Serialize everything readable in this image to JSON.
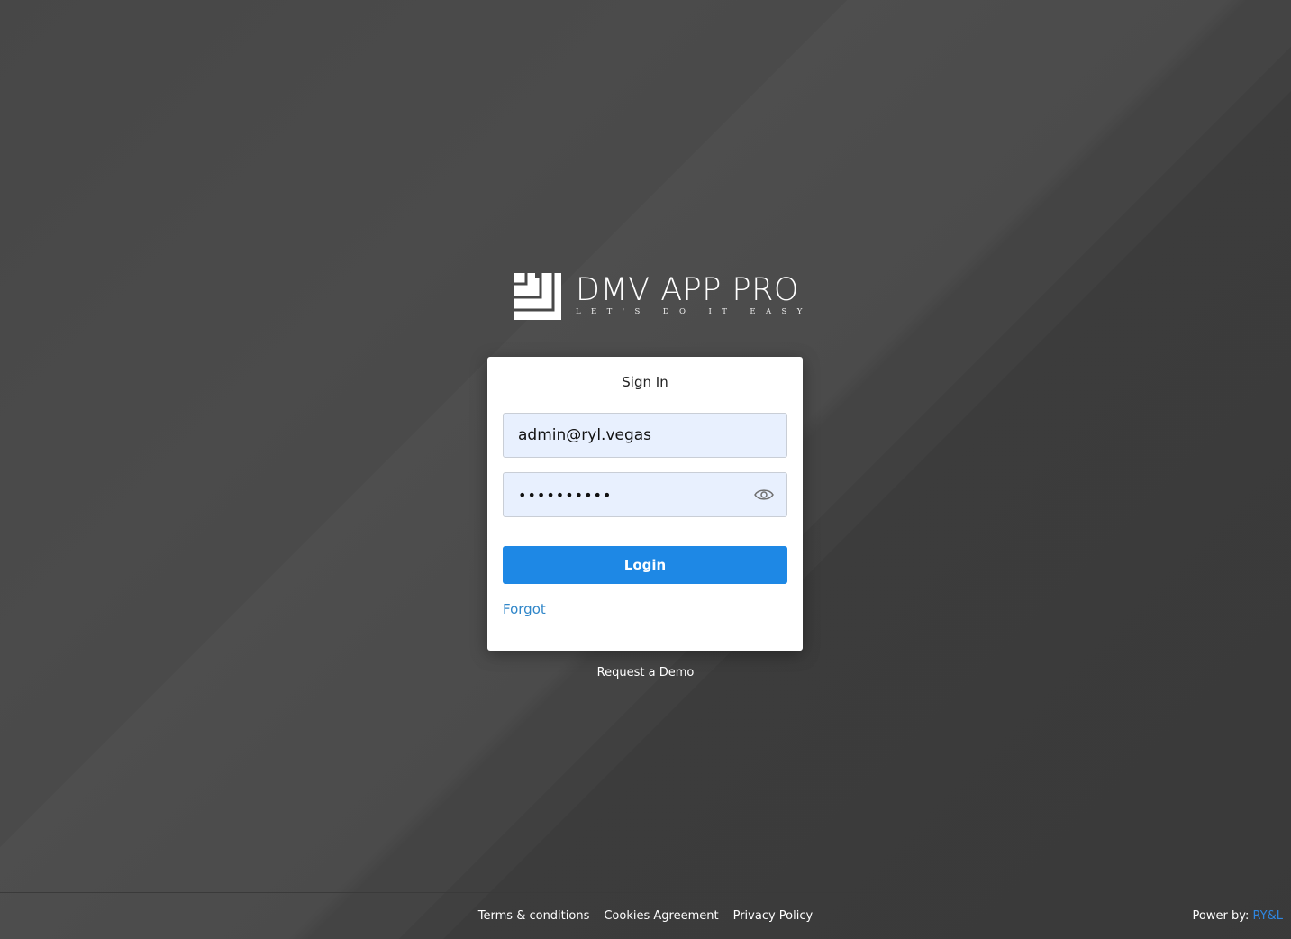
{
  "brand": {
    "title": "DMV APP PRO",
    "tagline": "LET'S DO IT EASY",
    "logo_icon": "stacked-squares-logo"
  },
  "signin": {
    "heading": "Sign In",
    "email_value": "admin@ryl.vegas",
    "password_value": "••••••••••",
    "password_toggle_icon": "eye-icon",
    "login_label": "Login",
    "forgot_label": "Forgot"
  },
  "request_demo_label": "Request a Demo",
  "footer": {
    "links": [
      "Terms & conditions",
      "Cookies Agreement",
      "Privacy Policy"
    ],
    "powered_prefix": "Power by: ",
    "powered_brand": "RY&L"
  },
  "colors": {
    "background": "#484848",
    "primary": "#1e88e5",
    "link": "#2f86c9",
    "input_bg": "#e8f0fe"
  }
}
